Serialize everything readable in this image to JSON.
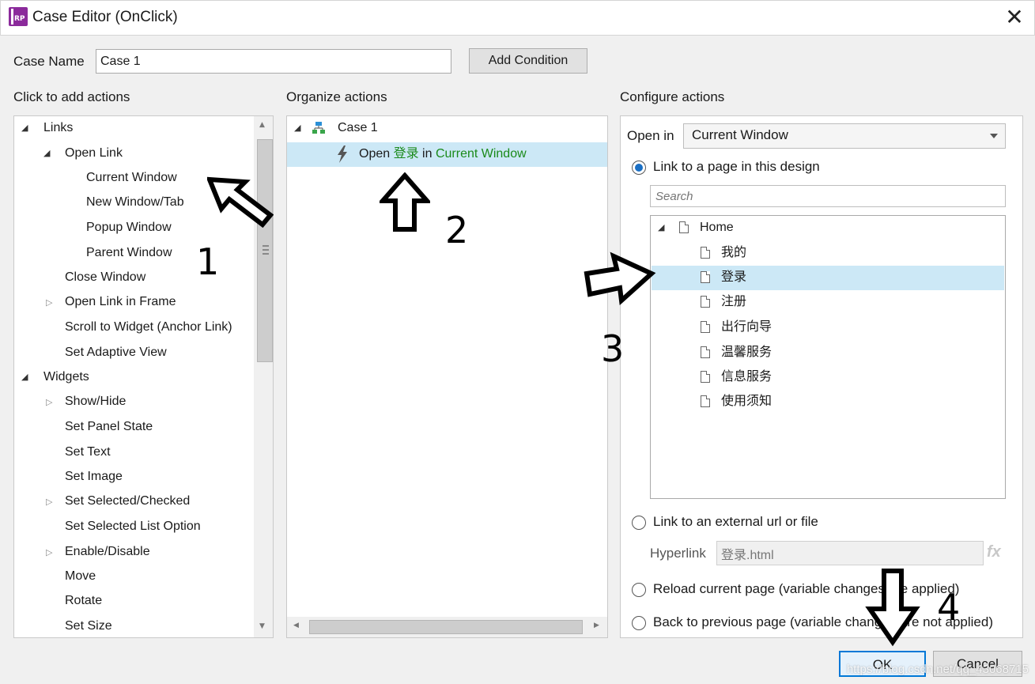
{
  "window": {
    "title": "Case Editor (OnClick)",
    "app_icon_text": "RP",
    "close_glyph": "✕"
  },
  "case_name": {
    "label": "Case Name",
    "value": "Case 1"
  },
  "add_condition_label": "Add Condition",
  "left": {
    "title": "Click to add actions",
    "items": [
      {
        "label": "Links",
        "expander": "open"
      },
      {
        "label": "Open Link",
        "expander": "open"
      },
      {
        "label": "Current Window",
        "expander": ""
      },
      {
        "label": "New Window/Tab",
        "expander": ""
      },
      {
        "label": "Popup Window",
        "expander": ""
      },
      {
        "label": "Parent Window",
        "expander": ""
      },
      {
        "label": "Close Window",
        "expander": ""
      },
      {
        "label": "Open Link in Frame",
        "expander": "closed"
      },
      {
        "label": "Scroll to Widget (Anchor Link)",
        "expander": ""
      },
      {
        "label": "Set Adaptive View",
        "expander": ""
      },
      {
        "label": "Widgets",
        "expander": "open"
      },
      {
        "label": "Show/Hide",
        "expander": "closed"
      },
      {
        "label": "Set Panel State",
        "expander": ""
      },
      {
        "label": "Set Text",
        "expander": ""
      },
      {
        "label": "Set Image",
        "expander": ""
      },
      {
        "label": "Set Selected/Checked",
        "expander": "closed"
      },
      {
        "label": "Set Selected List Option",
        "expander": ""
      },
      {
        "label": "Enable/Disable",
        "expander": "closed"
      },
      {
        "label": "Move",
        "expander": ""
      },
      {
        "label": "Rotate",
        "expander": ""
      },
      {
        "label": "Set Size",
        "expander": ""
      }
    ]
  },
  "middle": {
    "title": "Organize actions",
    "case_label": "Case 1",
    "action": {
      "prefix": "Open ",
      "page": "登录",
      "mid": " in ",
      "target": "Current Window"
    }
  },
  "right": {
    "title": "Configure actions",
    "open_in_label": "Open in",
    "open_in_value": "Current Window",
    "radio_link_page": "Link to a page in this design",
    "search_placeholder": "Search",
    "pages": {
      "root": "Home",
      "children": [
        "我的",
        "登录",
        "注册",
        "出行向导",
        "温馨服务",
        "信息服务",
        "使用须知"
      ],
      "selected": "登录"
    },
    "radio_external": "Link to an external url or file",
    "hyperlink_label": "Hyperlink",
    "hyperlink_value": "登录.html",
    "fx_label": "fx",
    "radio_reload": "Reload current page (variable changes are applied)",
    "radio_back": "Back to previous page (variable changes are not applied)"
  },
  "buttons": {
    "ok": "OK",
    "cancel": "Cancel"
  },
  "annotations": [
    "1",
    "2",
    "3",
    "4"
  ],
  "watermark": "https://blog.csdn.net/qq_43068715",
  "colors": {
    "selection": "#cce8f6",
    "link_green": "#1a8a1a",
    "radio_blue": "#1a6fc4",
    "ok_border": "#0078d7",
    "app_icon": "#8b2a9b"
  },
  "icons": {
    "case": "flow-icon",
    "action": "lightning-icon",
    "page": "page-icon"
  }
}
